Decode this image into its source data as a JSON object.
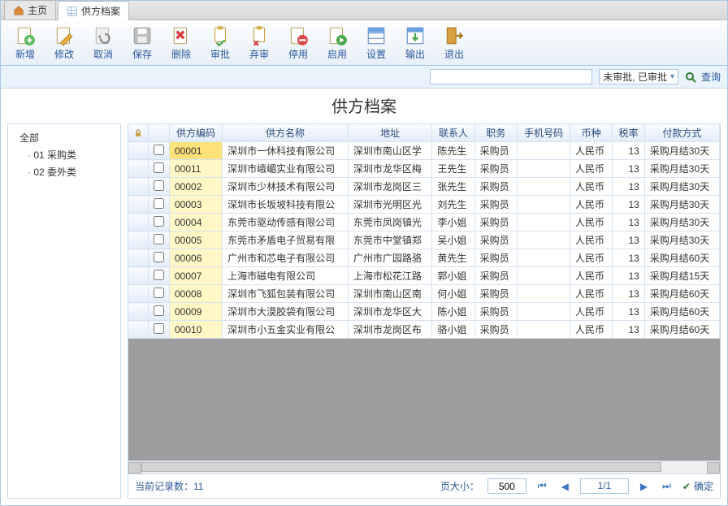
{
  "tabs": [
    {
      "label": "主页",
      "icon": "home-icon"
    },
    {
      "label": "供方档案",
      "icon": "grid-icon"
    }
  ],
  "active_tab": 1,
  "toolbar": [
    {
      "label": "新增",
      "name": "add-button",
      "icon": "add-icon"
    },
    {
      "label": "修改",
      "name": "edit-button",
      "icon": "edit-icon"
    },
    {
      "label": "取消",
      "name": "cancel-button",
      "icon": "undo-icon"
    },
    {
      "label": "保存",
      "name": "save-button",
      "icon": "save-icon"
    },
    {
      "label": "删除",
      "name": "delete-button",
      "icon": "delete-icon"
    },
    {
      "label": "审批",
      "name": "approve-button",
      "icon": "approve-icon"
    },
    {
      "label": "弃审",
      "name": "reject-button",
      "icon": "reject-icon"
    },
    {
      "label": "停用",
      "name": "disable-button",
      "icon": "disable-icon"
    },
    {
      "label": "启用",
      "name": "enable-button",
      "icon": "enable-icon"
    },
    {
      "label": "设置",
      "name": "settings-button",
      "icon": "settings-icon"
    },
    {
      "label": "输出",
      "name": "export-button",
      "icon": "export-icon"
    },
    {
      "label": "退出",
      "name": "exit-button",
      "icon": "exit-icon"
    }
  ],
  "filter": {
    "search_value": "",
    "search_placeholder": "",
    "status_label": "未审批, 已审批",
    "query_label": "查询"
  },
  "page_title": "供方档案",
  "tree": [
    {
      "label": "全部",
      "level": 0
    },
    {
      "label": "01 采购类",
      "level": 1
    },
    {
      "label": "02 委外类",
      "level": 1
    }
  ],
  "columns": [
    "供方编码",
    "供方名称",
    "地址",
    "联系人",
    "职务",
    "手机号码",
    "币种",
    "税率",
    "付款方式"
  ],
  "rows": [
    {
      "code": "00001",
      "name": "深圳市一休科技有限公司",
      "addr": "深圳市南山区学",
      "contact": "陈先生",
      "job": "采购员",
      "mobile": "",
      "currency": "人民币",
      "tax": "13",
      "pay": "采购月结30天"
    },
    {
      "code": "00011",
      "name": "深圳市峨嵋实业有限公司",
      "addr": "深圳市龙华区梅",
      "contact": "王先生",
      "job": "采购员",
      "mobile": "",
      "currency": "人民币",
      "tax": "13",
      "pay": "采购月结30天"
    },
    {
      "code": "00002",
      "name": "深圳市少林技术有限公司",
      "addr": "深圳市龙岗区三",
      "contact": "张先生",
      "job": "采购员",
      "mobile": "",
      "currency": "人民币",
      "tax": "13",
      "pay": "采购月结30天"
    },
    {
      "code": "00003",
      "name": "深圳市长坂坡科技有限公",
      "addr": "深圳市光明区光",
      "contact": "刘先生",
      "job": "采购员",
      "mobile": "",
      "currency": "人民币",
      "tax": "13",
      "pay": "采购月结30天"
    },
    {
      "code": "00004",
      "name": "东莞市驱动传感有限公司",
      "addr": "东莞市凤岗镇光",
      "contact": "李小姐",
      "job": "采购员",
      "mobile": "",
      "currency": "人民币",
      "tax": "13",
      "pay": "采购月结30天"
    },
    {
      "code": "00005",
      "name": "东莞市矛盾电子贸易有限",
      "addr": "东莞市中堂镇郑",
      "contact": "吴小姐",
      "job": "采购员",
      "mobile": "",
      "currency": "人民币",
      "tax": "13",
      "pay": "采购月结30天"
    },
    {
      "code": "00006",
      "name": "广州市和芯电子有限公司",
      "addr": "广州市广园路骆",
      "contact": "黄先生",
      "job": "采购员",
      "mobile": "",
      "currency": "人民币",
      "tax": "13",
      "pay": "采购月结60天"
    },
    {
      "code": "00007",
      "name": "上海市磁电有限公司",
      "addr": "上海市松花江路",
      "contact": "郭小姐",
      "job": "采购员",
      "mobile": "",
      "currency": "人民币",
      "tax": "13",
      "pay": "采购月结15天"
    },
    {
      "code": "00008",
      "name": "深圳市飞狐包装有限公司",
      "addr": "深圳市南山区南",
      "contact": "何小姐",
      "job": "采购员",
      "mobile": "",
      "currency": "人民币",
      "tax": "13",
      "pay": "采购月结60天"
    },
    {
      "code": "00009",
      "name": "深圳市大漠胶袋有限公司",
      "addr": "深圳市龙华区大",
      "contact": "陈小姐",
      "job": "采购员",
      "mobile": "",
      "currency": "人民币",
      "tax": "13",
      "pay": "采购月结60天"
    },
    {
      "code": "00010",
      "name": "深圳市小五金实业有限公",
      "addr": "深圳市龙岗区布",
      "contact": "骆小姐",
      "job": "采购员",
      "mobile": "",
      "currency": "人民币",
      "tax": "13",
      "pay": "采购月结60天"
    }
  ],
  "pager": {
    "record_label": "当前记录数：11",
    "page_size_label": "页大小：",
    "page_size_value": "500",
    "page_info": "1/1",
    "ok_label": "确定",
    "first_icon": "first-page-icon",
    "prev_icon": "prev-page-icon",
    "next_icon": "next-page-icon",
    "last_icon": "last-page-icon"
  }
}
